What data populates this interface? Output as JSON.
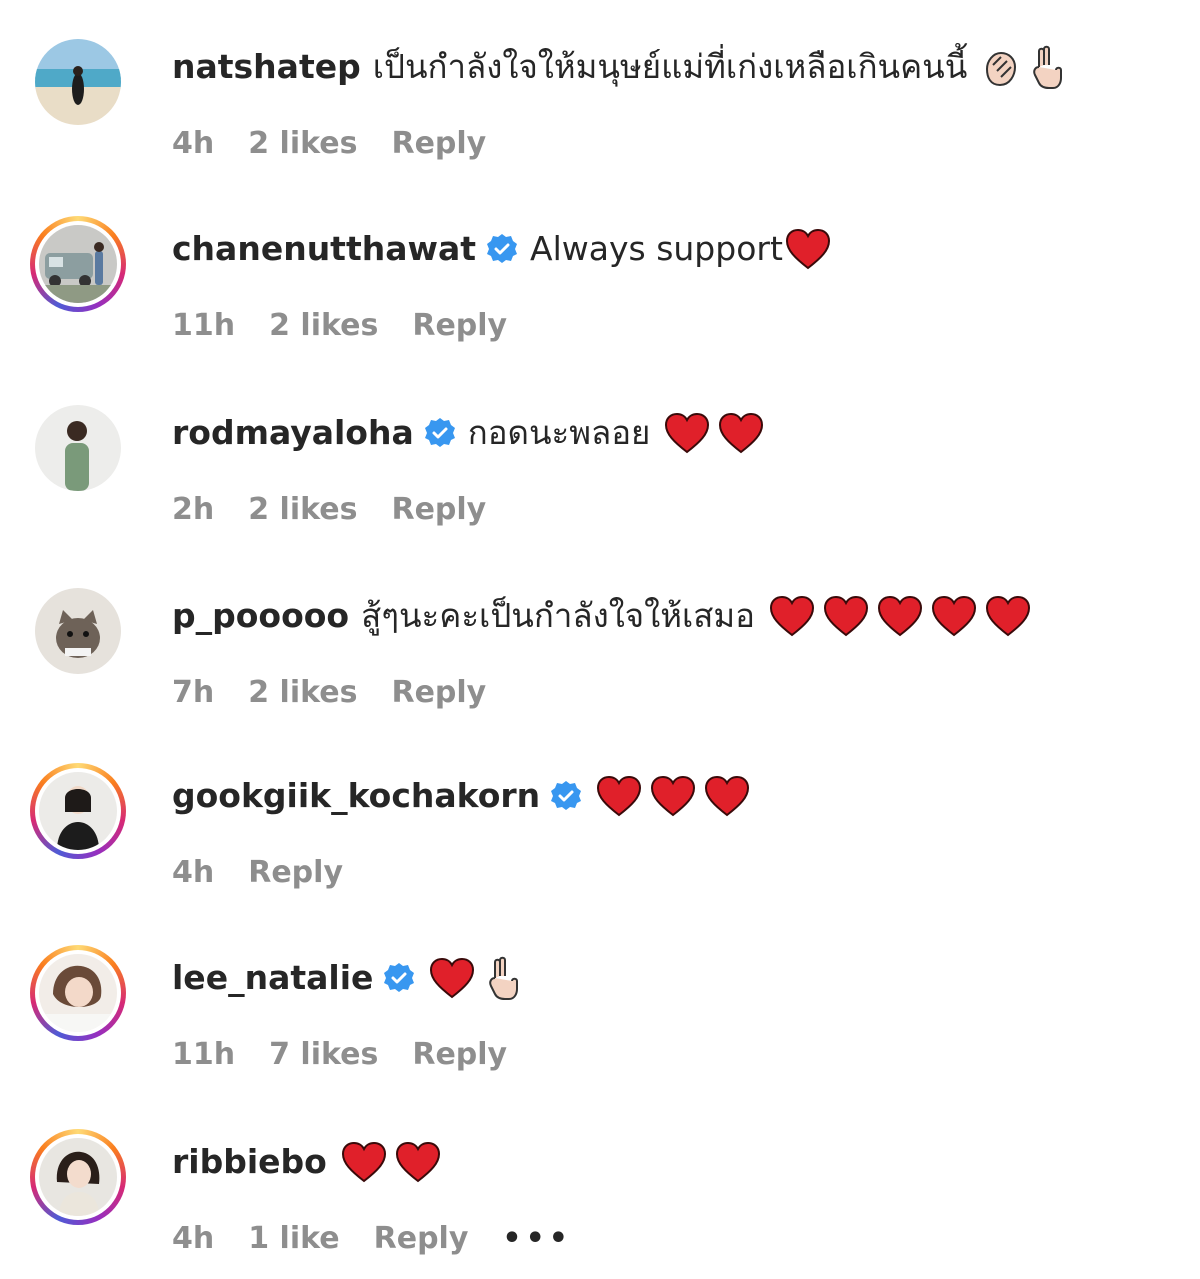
{
  "comments": [
    {
      "username": "natshatep",
      "verified": false,
      "text": "เป็นกำลังใจให้มนุษย์แม่ที่เก่งเหลือเกินคนนี้",
      "emojis": [
        "clapping-hands",
        "victory-hand"
      ],
      "time": "4h",
      "likes": "2 likes",
      "reply": "Reply",
      "avatar": "beach-photo"
    },
    {
      "username": "chanenutthawat",
      "verified": true,
      "text": "Always support",
      "emojis": [
        "heart"
      ],
      "time": "11h",
      "likes": "2 likes",
      "reply": "Reply",
      "avatar": "car-photo"
    },
    {
      "username": "rodmayaloha",
      "verified": true,
      "text": "กอดนะพลอย",
      "emojis": [
        "heart",
        "heart"
      ],
      "time": "2h",
      "likes": "2 likes",
      "reply": "Reply",
      "avatar": "person-photo"
    },
    {
      "username": "p_pooooo",
      "verified": false,
      "text": "สู้ๆนะคะเป็นกำลังใจให้เสมอ",
      "emojis": [
        "heart",
        "heart",
        "heart",
        "heart",
        "heart"
      ],
      "time": "7h",
      "likes": "2 likes",
      "reply": "Reply",
      "avatar": "cat-photo"
    },
    {
      "username": "gookgiik_kochakorn",
      "verified": true,
      "text": "",
      "emojis": [
        "heart",
        "heart",
        "heart"
      ],
      "time": "4h",
      "likes": "",
      "reply": "Reply",
      "avatar": "portrait-photo"
    },
    {
      "username": "lee_natalie",
      "verified": true,
      "text": "",
      "emojis": [
        "heart",
        "victory-hand"
      ],
      "time": "11h",
      "likes": "7 likes",
      "reply": "Reply",
      "avatar": "portrait-photo"
    },
    {
      "username": "ribbiebo",
      "verified": false,
      "text": "",
      "emojis": [
        "heart",
        "heart"
      ],
      "time": "4h",
      "likes": "1 like",
      "reply": "Reply",
      "more": "•••",
      "avatar": "portrait-photo"
    }
  ],
  "colors": {
    "username": "#262626",
    "meta": "#8e8e8e",
    "verified": "#3897f0",
    "heart": "#e0202a"
  }
}
